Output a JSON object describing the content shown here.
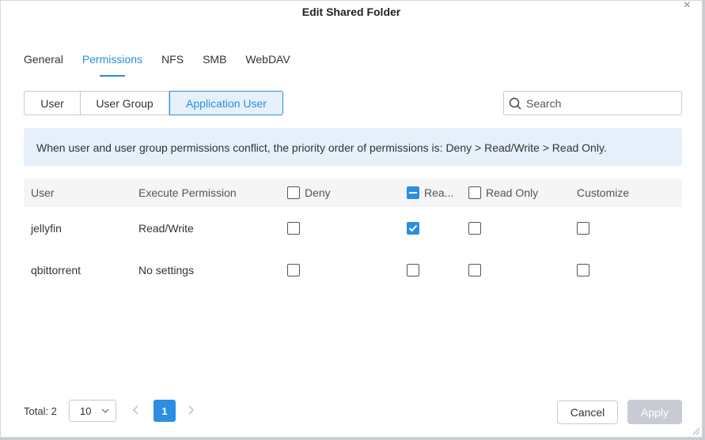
{
  "dialog": {
    "title": "Edit Shared Folder",
    "close_glyph": "×"
  },
  "tabs": [
    {
      "label": "General",
      "active": false
    },
    {
      "label": "Permissions",
      "active": true
    },
    {
      "label": "NFS",
      "active": false
    },
    {
      "label": "SMB",
      "active": false
    },
    {
      "label": "WebDAV",
      "active": false
    }
  ],
  "segments": [
    {
      "label": "User",
      "active": false
    },
    {
      "label": "User Group",
      "active": false
    },
    {
      "label": "Application User",
      "active": true
    }
  ],
  "search": {
    "placeholder": "Search",
    "value": ""
  },
  "notice": "When user and user group permissions conflict, the priority order of permissions is: Deny > Read/Write > Read Only.",
  "table": {
    "headers": {
      "user": "User",
      "execute": "Execute Permission",
      "deny": "Deny",
      "readwrite": "Rea...",
      "readonly": "Read Only",
      "customize": "Customize"
    },
    "header_checks": {
      "deny": "unchecked",
      "readwrite": "partial",
      "readonly": "unchecked"
    },
    "rows": [
      {
        "user": "jellyfin",
        "execute": "Read/Write",
        "deny": false,
        "readwrite": true,
        "readonly": false,
        "customize": false
      },
      {
        "user": "qbittorrent",
        "execute": "No settings",
        "deny": false,
        "readwrite": false,
        "readonly": false,
        "customize": false
      }
    ]
  },
  "footer": {
    "total": "Total: 2",
    "page_size": "10",
    "current_page": "1",
    "cancel_label": "Cancel",
    "apply_label": "Apply"
  },
  "colors": {
    "accent": "#2b8ee0",
    "notice_bg": "#e6f0fb",
    "disabled": "#c8ccd2"
  }
}
